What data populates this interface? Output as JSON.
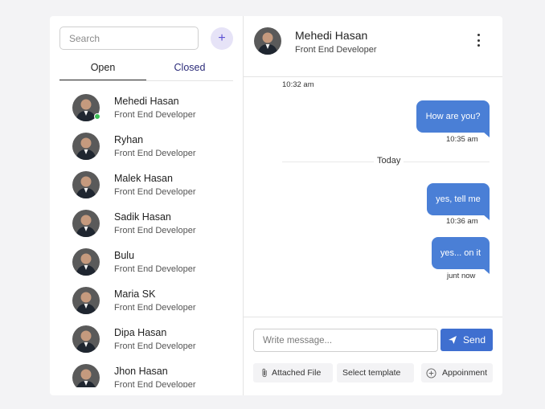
{
  "sidebar": {
    "search_placeholder": "Search",
    "add_icon": "plus-icon",
    "tabs": {
      "open": "Open",
      "closed": "Closed"
    },
    "contacts": [
      {
        "name": "Mehedi Hasan",
        "role": "Front End Developer",
        "online": true
      },
      {
        "name": "Ryhan",
        "role": "Front End Developer",
        "online": false
      },
      {
        "name": "Malek Hasan",
        "role": "Front End Developer",
        "online": false
      },
      {
        "name": "Sadik Hasan",
        "role": "Front End Developer",
        "online": false
      },
      {
        "name": "Bulu",
        "role": "Front End Developer",
        "online": false
      },
      {
        "name": "Maria SK",
        "role": "Front End Developer",
        "online": false
      },
      {
        "name": "Dipa Hasan",
        "role": "Front End Developer",
        "online": false
      },
      {
        "name": "Jhon Hasan",
        "role": "Front End Developer",
        "online": false
      }
    ]
  },
  "chat": {
    "header": {
      "name": "Mehedi Hasan",
      "role": "Front End Developer",
      "menu_icon": "kebab-menu-icon"
    },
    "first_time": "10:32 am",
    "messages": [
      {
        "text": "How are you?",
        "time": "10:35 am"
      },
      {
        "text": "yes, tell me",
        "time": "10:36 am"
      },
      {
        "text": "yes... on it",
        "time": "junt now"
      }
    ],
    "day_divider": "Today"
  },
  "composer": {
    "placeholder": "Write message...",
    "send_label": "Send",
    "attach_label": "Attached File",
    "template_label": "Select template",
    "appointment_label": "Appoinment"
  },
  "colors": {
    "accent": "#3f6fd0",
    "bubble": "#4a7fd6",
    "online": "#3cbf55",
    "add_button_bg": "#e6e3f7"
  }
}
